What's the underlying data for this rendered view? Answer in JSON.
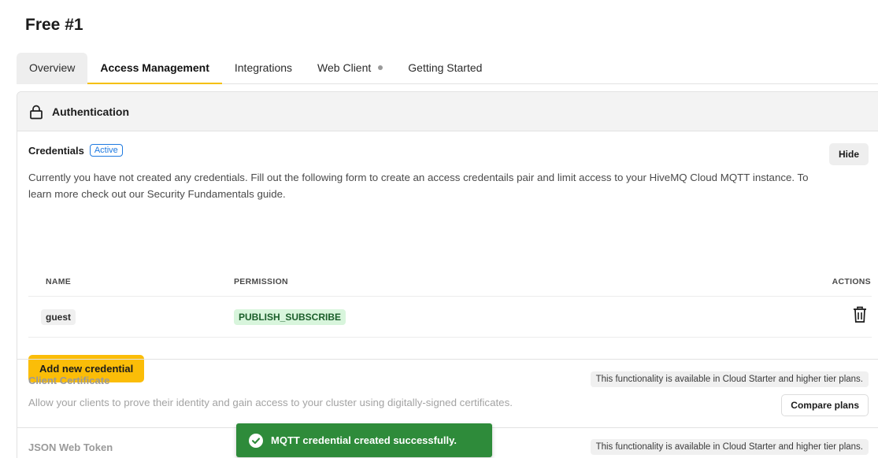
{
  "page": {
    "title": "Free #1"
  },
  "tabs": [
    {
      "label": "Overview"
    },
    {
      "label": "Access Management"
    },
    {
      "label": "Integrations"
    },
    {
      "label": "Web Client"
    },
    {
      "label": "Getting Started"
    }
  ],
  "auth": {
    "header": "Authentication",
    "credentials": {
      "title": "Credentials",
      "status": "Active",
      "hide_label": "Hide",
      "description": "Currently you have not created any credentials. Fill out the following form to create an access credentails pair and limit access to your HiveMQ Cloud MQTT instance. To learn more check out our Security Fundamentals guide.",
      "columns": {
        "name": "NAME",
        "permission": "PERMISSION",
        "actions": "ACTIONS"
      },
      "rows": [
        {
          "name": "guest",
          "permission": "PUBLISH_SUBSCRIBE"
        }
      ],
      "add_label": "Add new credential"
    },
    "client_certificate": {
      "title": "Client Certificate",
      "tier_note": "This functionality is available in Cloud Starter and higher tier plans.",
      "description": "Allow your clients to prove their identity and gain access to your cluster using digitally-signed certificates.",
      "compare_label": "Compare plans"
    },
    "jwt": {
      "title": "JSON Web Token",
      "tier_note": "This functionality is available in Cloud Starter and higher tier plans."
    }
  },
  "toast": {
    "message": "MQTT credential created successfully."
  },
  "colors": {
    "accent": "#fbbd08",
    "tab_underline": "#f5c000",
    "success": "#2e8b3a",
    "active_badge": "#1f7ae0",
    "permission_bg": "#d8f5dc"
  },
  "icons": {
    "auth": "lock-icon",
    "delete": "trash-icon",
    "toast": "check-circle-icon",
    "web_client_status": "status-dot-icon"
  }
}
